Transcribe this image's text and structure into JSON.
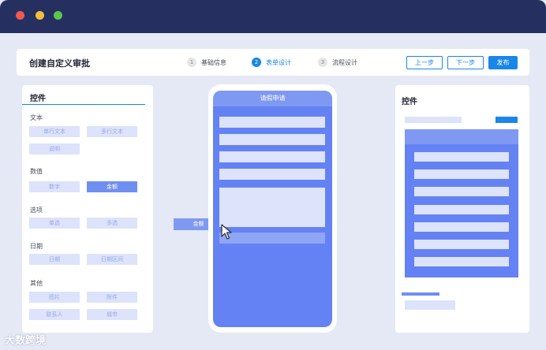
{
  "window": {
    "dots": [
      "close",
      "minimize",
      "maximize"
    ]
  },
  "header": {
    "title": "创建自定义审批",
    "steps": [
      {
        "num": "1",
        "label": "基础信息",
        "active": false
      },
      {
        "num": "2",
        "label": "表单设计",
        "active": true
      },
      {
        "num": "3",
        "label": "流程设计",
        "active": false
      }
    ],
    "prev_label": "上一步",
    "next_label": "下一步",
    "publish_label": "发布"
  },
  "controls": {
    "title": "控件",
    "groups": [
      {
        "label": "文本",
        "items": [
          "单行文本",
          "多行文本",
          "说明"
        ]
      },
      {
        "label": "数值",
        "items": [
          "数字",
          "金额"
        ]
      },
      {
        "label": "选项",
        "items": [
          "单选",
          "多选"
        ]
      },
      {
        "label": "日期",
        "items": [
          "日期",
          "日期区间"
        ]
      },
      {
        "label": "其他",
        "items": [
          "图片",
          "附件",
          "联系人",
          "城市"
        ]
      }
    ],
    "selected": "金额"
  },
  "dragging": {
    "label": "金额"
  },
  "phone": {
    "header": "请假申请"
  },
  "properties": {
    "title": "控件"
  },
  "colors": {
    "accent": "#1a86e8",
    "frame": "#253061",
    "form": "#6482f3",
    "field": "#dce3fb"
  },
  "watermark": "大数跨境"
}
